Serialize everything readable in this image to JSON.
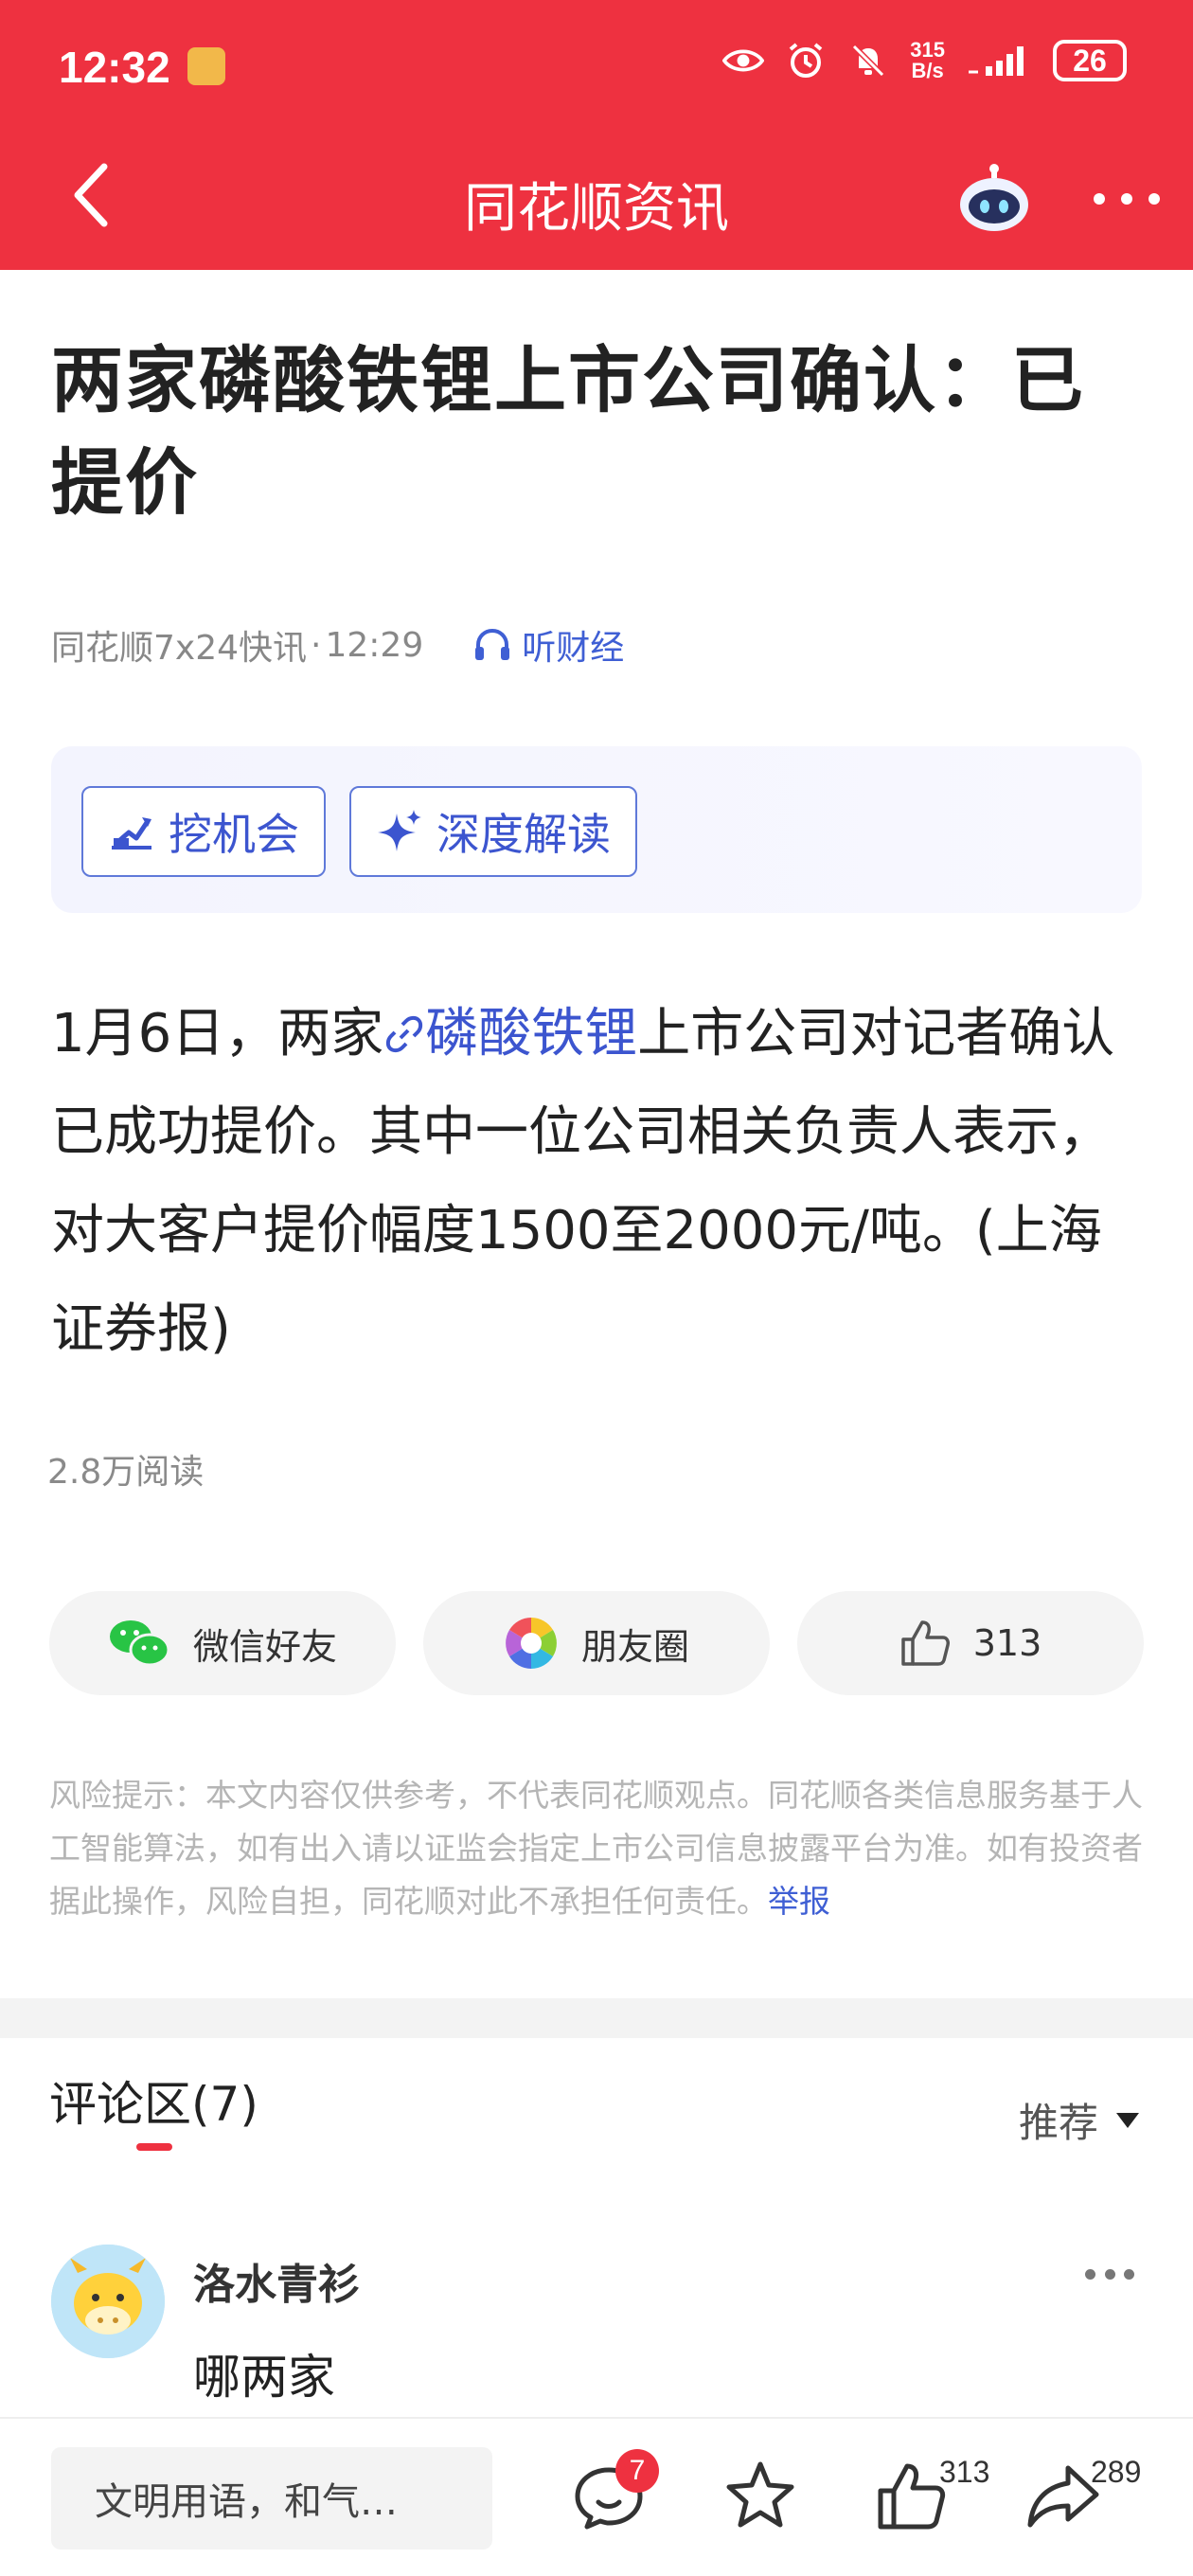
{
  "status_bar": {
    "time": "12:32",
    "net_speed_value": "315",
    "net_speed_unit": "B/s",
    "battery": "26"
  },
  "header": {
    "title": "同花顺资讯",
    "back_icon": "chevron-left-icon",
    "assistant_icon": "robot-icon",
    "more_icon": "more-dots-icon"
  },
  "article": {
    "title": "两家磷酸铁锂上市公司确认：已提价",
    "source": "同花顺7x24快讯",
    "separator": "·",
    "time": "12:29",
    "listen_label": "听财经",
    "tools": [
      {
        "label": "挖机会",
        "icon": "excavator-icon"
      },
      {
        "label": "深度解读",
        "icon": "sparkle-icon"
      }
    ],
    "content_before": "1月6日，两家",
    "content_link": "磷酸铁锂",
    "content_after": "上市公司对记者确认已成功提价。其中一位公司相关负责人表示，对大客户提价幅度1500至2000元/吨。(上海证券报)",
    "reads": "2.8万阅读"
  },
  "share": {
    "wechat_label": "微信好友",
    "moments_label": "朋友圈",
    "like_count": "313"
  },
  "risk_notice": {
    "text": "风险提示：本文内容仅供参考，不代表同花顺观点。同花顺各类信息服务基于人工智能算法，如有出入请以证监会指定上市公司信息披露平台为准。如有投资者据此操作，风险自担，同花顺对此不承担任何责任。",
    "report_label": "举报"
  },
  "comments": {
    "title": "评论区(7)",
    "sort_label": "推荐",
    "items": [
      {
        "name": "洛水青衫",
        "text": "哪两家"
      }
    ]
  },
  "bottom_bar": {
    "input_placeholder": "文明用语，和气…",
    "comment_badge": "7",
    "like_count": "313",
    "share_count": "289"
  },
  "colors": {
    "brand_red": "#ee3140",
    "link_blue": "#3c55cf"
  }
}
